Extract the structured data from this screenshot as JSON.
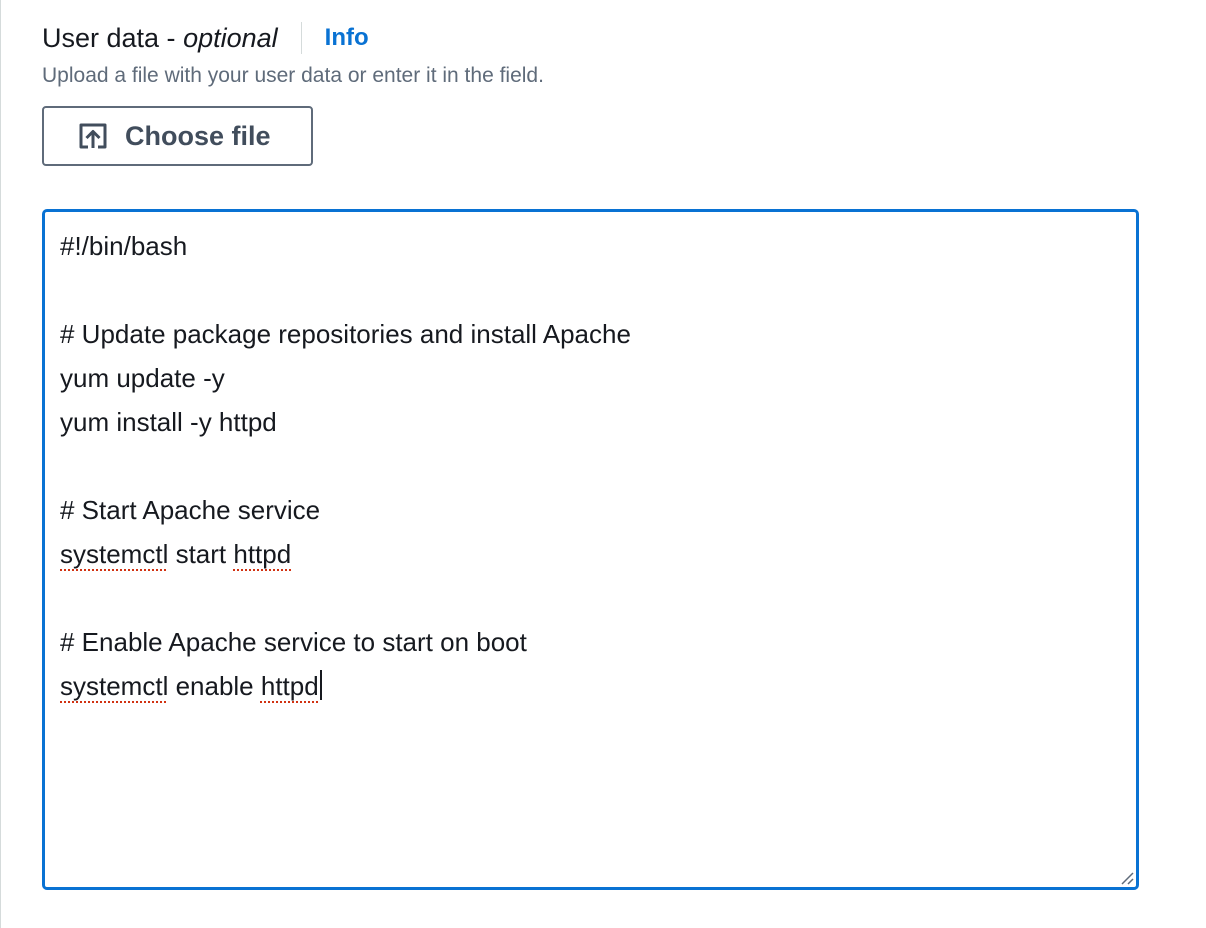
{
  "field": {
    "label": "User data - ",
    "label_optional": "optional",
    "info_link": "Info",
    "description": "Upload a file with your user data or enter it in the field."
  },
  "choose_file": {
    "label": "Choose file",
    "icon": "upload-icon"
  },
  "userdata": {
    "line_1": "#!/bin/bash",
    "line_2": "",
    "line_3": "# Update package repositories and install Apache",
    "line_4": "yum update -y",
    "line_5": "yum install -y httpd",
    "line_6": "",
    "line_7": "# Start Apache service",
    "line_8a": "systemctl",
    "line_8b": " start ",
    "line_8c": "httpd",
    "line_9": "",
    "line_10": "# Enable Apache service to start on boot",
    "line_11a": "systemctl",
    "line_11b": " enable ",
    "line_11c": "httpd"
  },
  "colors": {
    "accent": "#0972d3",
    "text": "#16191f",
    "muted": "#5f6b7a",
    "spellcheck": "#d13212"
  }
}
